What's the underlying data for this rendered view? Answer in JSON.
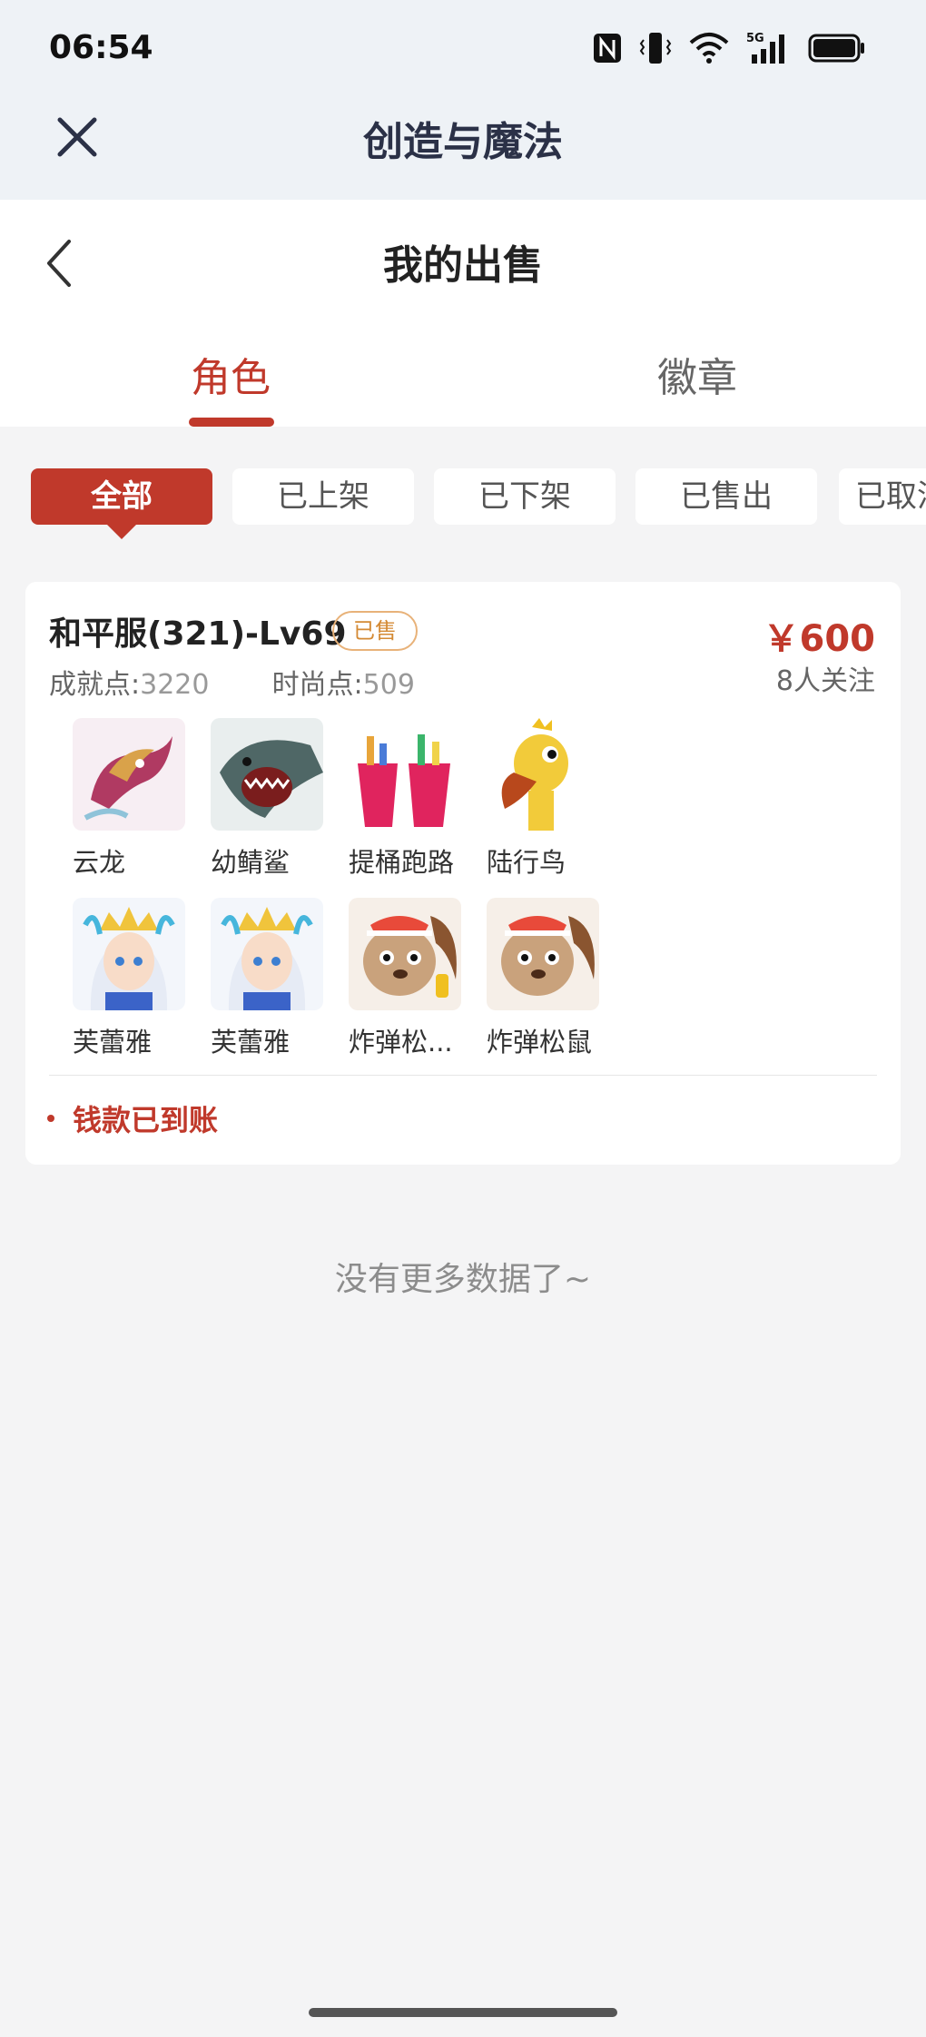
{
  "status_bar": {
    "time": "06:54"
  },
  "app_bar": {
    "title": "创造与魔法"
  },
  "header": {
    "title": "我的出售"
  },
  "tabs": [
    {
      "label": "角色",
      "active": true
    },
    {
      "label": "徽章",
      "active": false
    }
  ],
  "filters": [
    {
      "label": "全部",
      "active": true
    },
    {
      "label": "已上架",
      "active": false
    },
    {
      "label": "已下架",
      "active": false
    },
    {
      "label": "已售出",
      "active": false
    },
    {
      "label": "已取消",
      "active": false
    }
  ],
  "listing": {
    "title": "和平服(321)-Lv69",
    "badge": "已售",
    "price": "￥600",
    "followers": "8人关注",
    "achievement_label": "成就点:",
    "achievement_value": "3220",
    "fashion_label": "时尚点:",
    "fashion_value": "509",
    "items": [
      {
        "name": "云龙",
        "icon": "dragon-icon"
      },
      {
        "name": "幼鲭鲨",
        "icon": "shark-icon"
      },
      {
        "name": "提桶跑路",
        "icon": "bucket-icon"
      },
      {
        "name": "陆行鸟",
        "icon": "bird-icon"
      },
      {
        "name": "芙蕾雅",
        "icon": "character-icon"
      },
      {
        "name": "芙蕾雅",
        "icon": "character-icon"
      },
      {
        "name": "炸弹松...",
        "icon": "squirrel-icon"
      },
      {
        "name": "炸弹松鼠",
        "icon": "squirrel-icon"
      }
    ],
    "payment_status": "钱款已到账"
  },
  "footer": {
    "no_more_text": "没有更多数据了~"
  },
  "colors": {
    "accent": "#c0392b",
    "badge_border": "#e8b279",
    "badge_text": "#d48a34"
  }
}
